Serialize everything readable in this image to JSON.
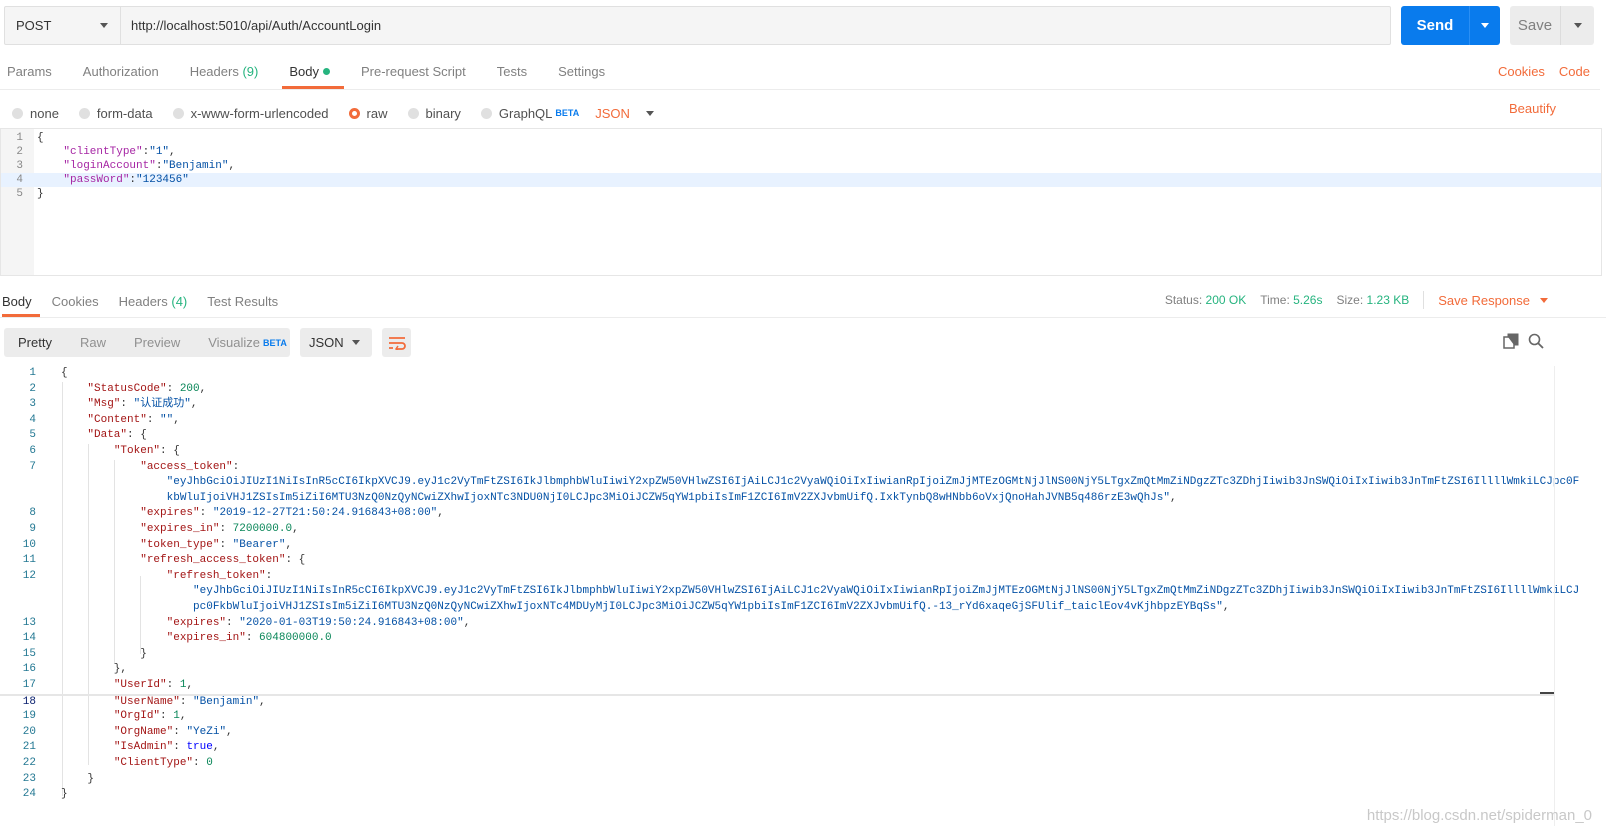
{
  "request": {
    "method": "POST",
    "url": "http://localhost:5010/api/Auth/AccountLogin",
    "send_label": "Send",
    "save_label": "Save"
  },
  "request_tabs": {
    "params": "Params",
    "authorization": "Authorization",
    "headers": "Headers",
    "headers_count": "(9)",
    "body": "Body",
    "prerequest": "Pre-request Script",
    "tests": "Tests",
    "settings": "Settings",
    "cookies": "Cookies",
    "code": "Code"
  },
  "body_types": {
    "none": "none",
    "form_data": "form-data",
    "urlencoded": "x-www-form-urlencoded",
    "raw": "raw",
    "binary": "binary",
    "graphql": "GraphQL",
    "beta": "BETA",
    "format": "JSON",
    "beautify": "Beautify"
  },
  "request_body": {
    "line_numbers": [
      "1",
      "2",
      "3",
      "4",
      "5"
    ],
    "open": "{",
    "k_clientType": "\"clientType\"",
    "v_clientType": "\"1\"",
    "k_loginAccount": "\"loginAccount\"",
    "v_loginAccount": "\"Benjamin\"",
    "k_passWord": "\"passWord\"",
    "v_passWord": "\"123456\"",
    "close": "}"
  },
  "response_tabs": {
    "body": "Body",
    "cookies": "Cookies",
    "headers": "Headers",
    "headers_count": "(4)",
    "test_results": "Test Results"
  },
  "response_status": {
    "status_label": "Status:",
    "status_value": "200 OK",
    "time_label": "Time:",
    "time_value": "5.26s",
    "size_label": "Size:",
    "size_value": "1.23 KB",
    "save_response": "Save Response"
  },
  "response_view": {
    "pretty": "Pretty",
    "raw": "Raw",
    "preview": "Preview",
    "visualize": "Visualize",
    "beta": "BETA",
    "format": "JSON"
  },
  "response_body": {
    "line_numbers": [
      "1",
      "2",
      "3",
      "4",
      "5",
      "6",
      "7",
      "",
      "8",
      "9",
      "10",
      "11",
      "12",
      "",
      "13",
      "14",
      "15",
      "16",
      "17",
      "18",
      "19",
      "20",
      "21",
      "22",
      "23",
      "24"
    ],
    "l1": "{",
    "k_status": "\"StatusCode\"",
    "v_status": "200",
    "k_msg": "\"Msg\"",
    "v_msg": "\"认证成功\"",
    "k_content": "\"Content\"",
    "v_content": "\"\"",
    "k_data": "\"Data\"",
    "k_token": "\"Token\"",
    "k_access_token": "\"access_token\"",
    "v_access_token_1": "\"eyJhbGciOiJIUzI1NiIsInR5cCI6IkpXVCJ9.eyJ1c2VyTmFtZSI6IkJlbmphbWluIiwiY2xpZW50VHlwZSI6IjAiLCJ1c2VyaWQiOiIxIiwianRpIjoiZmJjMTEzOGMtNjJlNS00NjY5LTgxZmQtMmZiNDgzZTc3ZDhjIiwib3JnSWQiOiIxIiwib3JnTmFtZSI6IllllWmkiLCJpc0F",
    "v_access_token_2": "kbWluIjoiVHJ1ZSIsIm5iZiI6MTU3NzQ0NzQyNCwiZXhwIjoxNTc3NDU0NjI0LCJpc3MiOiJCZW5qYW1pbiIsImF1ZCI6ImV2ZXJvbmUifQ.IxkTynbQ8wHNbb6oVxjQnoHahJVNB5q486rzE3wQhJs\"",
    "k_expires": "\"expires\"",
    "v_expires": "\"2019-12-27T21:50:24.916843+08:00\"",
    "k_expires_in": "\"expires_in\"",
    "v_expires_in": "7200000.0",
    "k_token_type": "\"token_type\"",
    "v_token_type": "\"Bearer\"",
    "k_refresh_access_token": "\"refresh_access_token\"",
    "k_refresh_token": "\"refresh_token\"",
    "v_refresh_token_1": "\"eyJhbGciOiJIUzI1NiIsInR5cCI6IkpXVCJ9.eyJ1c2VyTmFtZSI6IkJlbmphbWluIiwiY2xpZW50VHlwZSI6IjAiLCJ1c2VyaWQiOiIxIiwianRpIjoiZmJjMTEzOGMtNjJlNS00NjY5LTgxZmQtMmZiNDgzZTc3ZDhjIiwib3JnSWQiOiIxIiwib3JnTmFtZSI6IllllWmkiLCJ",
    "v_refresh_token_2": "pc0FkbWluIjoiVHJ1ZSIsIm5iZiI6MTU3NzQ0NzQyNCwiZXhwIjoxNTc4MDUyMjI0LCJpc3MiOiJCZW5qYW1pbiIsImF1ZCI6ImV2ZXJvbmUifQ.-13_rYd6xaqeGjSFUlif_taiclEov4vKjhbpzEYBqSs\"",
    "k_r_expires": "\"expires\"",
    "v_r_expires": "\"2020-01-03T19:50:24.916843+08:00\"",
    "k_r_expires_in": "\"expires_in\"",
    "v_r_expires_in": "604800000.0",
    "k_userid": "\"UserId\"",
    "v_userid": "1",
    "k_username": "\"UserName\"",
    "v_username": "\"Benjamin\"",
    "k_orgid": "\"OrgId\"",
    "v_orgid": "1",
    "k_orgname": "\"OrgName\"",
    "v_orgname": "\"YeZi\"",
    "k_isadmin": "\"IsAdmin\"",
    "v_isadmin": "true",
    "k_clienttype": "\"ClientType\"",
    "v_clienttype": "0"
  },
  "watermark": "https://blog.csdn.net/spiderman_0",
  "colors": {
    "accent": "#f26b3a",
    "send": "#097bed",
    "success": "#26b47f"
  },
  "icons": [
    "chevron-down-icon",
    "wrap-lines-icon",
    "copy-icon",
    "search-icon",
    "radio-icon"
  ]
}
